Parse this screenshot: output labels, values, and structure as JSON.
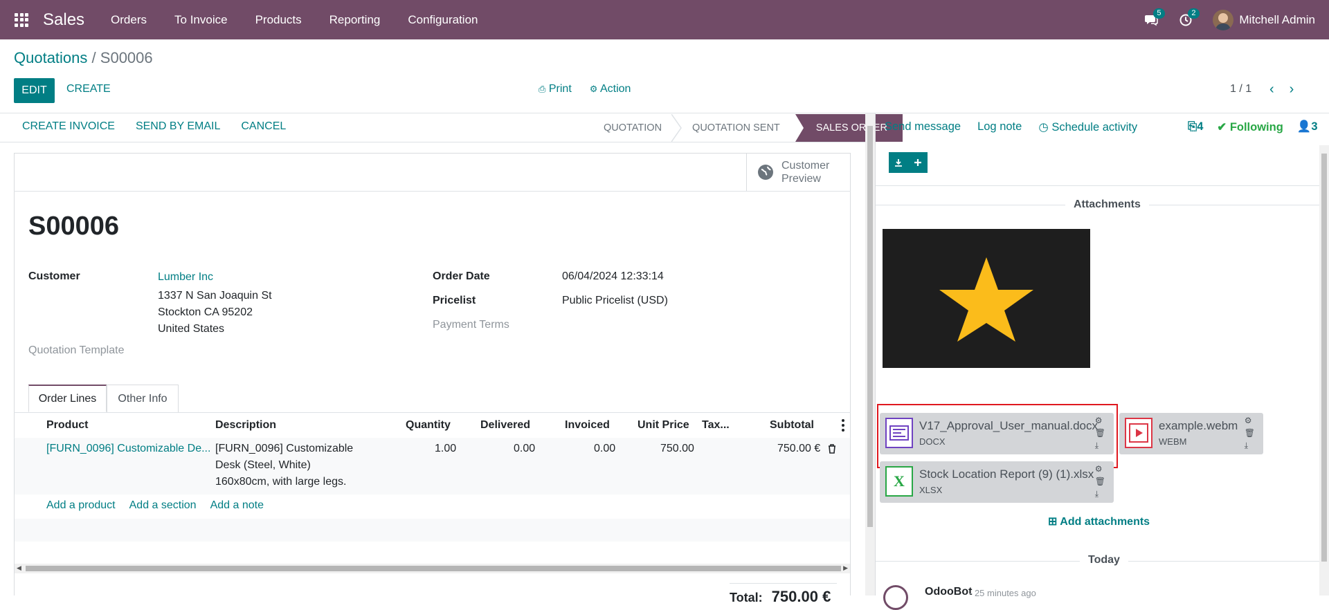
{
  "navbar": {
    "app_name": "Sales",
    "menu": [
      "Orders",
      "To Invoice",
      "Products",
      "Reporting",
      "Configuration"
    ],
    "messages_count": "5",
    "activities_count": "2",
    "user_name": "Mitchell Admin"
  },
  "breadcrumb": {
    "parent": "Quotations",
    "separator": "/",
    "current": "S00006"
  },
  "control_panel": {
    "edit_label": "EDIT",
    "create_label": "CREATE",
    "print_label": "Print",
    "action_label": "Action",
    "pager_value": "1 / 1"
  },
  "statusbar": {
    "buttons": [
      "CREATE INVOICE",
      "SEND BY EMAIL",
      "CANCEL"
    ],
    "stages": [
      "QUOTATION",
      "QUOTATION SENT",
      "SALES ORDER"
    ],
    "active_stage": "SALES ORDER"
  },
  "form": {
    "preview_label_1": "Customer",
    "preview_label_2": "Preview",
    "title": "S00006",
    "customer_label": "Customer",
    "customer_name": "Lumber Inc",
    "address_line1": "1337 N San Joaquin St",
    "address_line2": "Stockton CA 95202",
    "address_line3": "United States",
    "quotation_template_label": "Quotation Template",
    "order_date_label": "Order Date",
    "order_date_value": "06/04/2024 12:33:14",
    "pricelist_label": "Pricelist",
    "pricelist_value": "Public Pricelist (USD)",
    "payment_terms_label": "Payment Terms"
  },
  "tabs": [
    "Order Lines",
    "Other Info"
  ],
  "order_lines": {
    "columns": [
      "Product",
      "Description",
      "Quantity",
      "Delivered",
      "Invoiced",
      "Unit Price",
      "Tax...",
      "Subtotal"
    ],
    "rows": [
      {
        "product": "[FURN_0096] Customizable De...",
        "description_1": "[FURN_0096] Customizable",
        "description_2": "Desk (Steel, White)",
        "description_3": "160x80cm, with large legs.",
        "quantity": "1.00",
        "delivered": "0.00",
        "invoiced": "0.00",
        "unit_price": "750.00",
        "subtotal": "750.00 €"
      }
    ],
    "add_links": [
      "Add a product",
      "Add a section",
      "Add a note"
    ],
    "total_label": "Total:",
    "total_value": "750.00 €"
  },
  "chatter": {
    "send_message": "Send message",
    "log_note": "Log note",
    "schedule_activity": "Schedule activity",
    "attachment_count": "4",
    "following": "Following",
    "followers_count": "3",
    "attachments_title": "Attachments",
    "files": [
      {
        "name": "V17_Approval_User_manual.docx",
        "ext": "DOCX"
      },
      {
        "name": "example.webm",
        "ext": "WEBM"
      },
      {
        "name": "Stock Location Report (9) (1).xlsx",
        "ext": "XLSX"
      }
    ],
    "add_attachments": "Add attachments",
    "today_label": "Today",
    "message_author": "OdooBot",
    "message_time": "- 25 minutes ago"
  },
  "colors": {
    "brand": "#714b67",
    "accent": "#017e84",
    "highlight": "#e0181f",
    "star": "#fbbc1b"
  }
}
